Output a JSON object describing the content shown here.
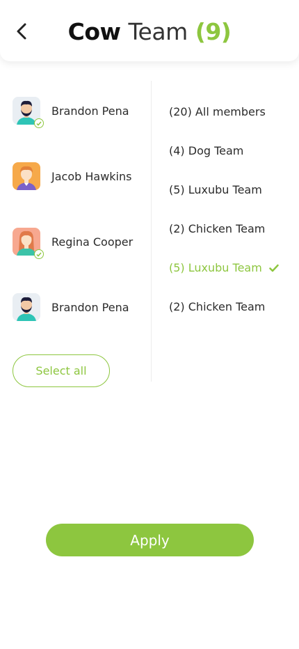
{
  "header": {
    "title_part1": "Cow",
    "title_part2": "Team",
    "title_count": "(9)"
  },
  "members": [
    {
      "name": "Brandon Pena",
      "avatar": "man-beard-avatar-icon",
      "selected": true
    },
    {
      "name": "Jacob Hawkins",
      "avatar": "man-orange-avatar-icon",
      "selected": false
    },
    {
      "name": "Regina Cooper",
      "avatar": "woman-avatar-icon",
      "selected": true
    },
    {
      "name": "Brandon Pena",
      "avatar": "man-beard-avatar-icon",
      "selected": false
    }
  ],
  "select_all_label": "Select all",
  "teams": [
    {
      "label": "(20) All members",
      "active": false
    },
    {
      "label": "(4) Dog Team",
      "active": false
    },
    {
      "label": "(5) Luxubu Team",
      "active": false
    },
    {
      "label": "(2) Chicken Team",
      "active": false
    },
    {
      "label": "(5) Luxubu Team",
      "active": true
    },
    {
      "label": "(2) Chicken Team",
      "active": false
    }
  ],
  "apply_label": "Apply",
  "colors": {
    "accent": "#8dc63f",
    "text": "#2b2b2b"
  }
}
